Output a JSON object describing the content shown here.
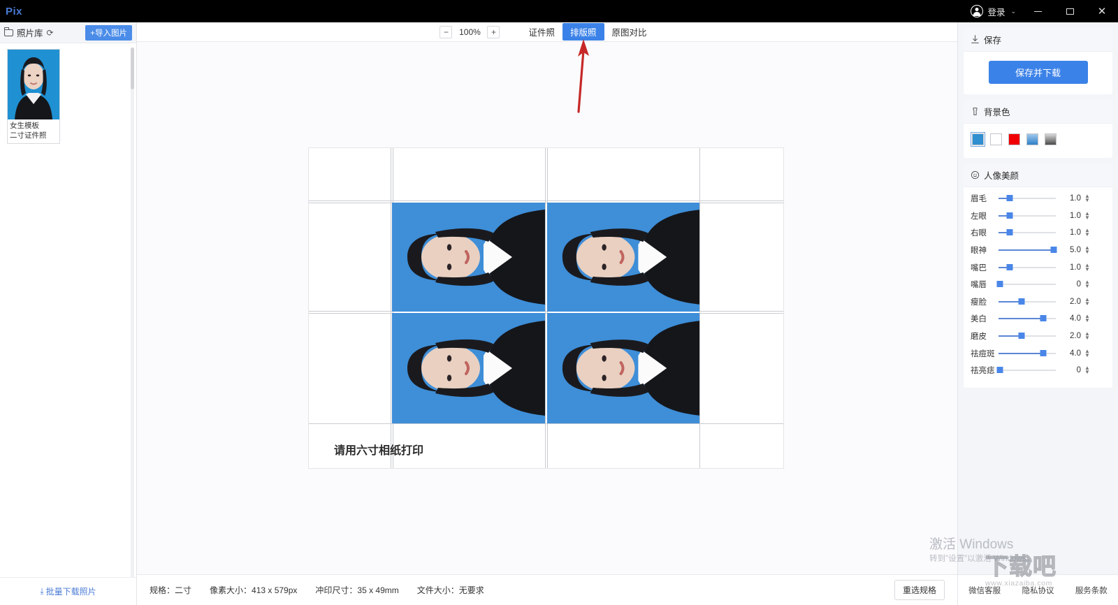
{
  "titlebar": {
    "brand": "Pix",
    "login_label": "登录",
    "chevron": "⌄",
    "minimize": "minimize",
    "maximize": "maximize",
    "close": "✕"
  },
  "sidebar": {
    "library_title": "照片库",
    "refresh_icon": "⟳",
    "import_label": "+导入图片",
    "photos": [
      {
        "name": "女生模板",
        "spec": "二寸证件照"
      }
    ],
    "batch_download": "批量下载照片",
    "batch_download_icon": "⤓"
  },
  "toolbar": {
    "zoom_out": "−",
    "zoom_value": "100%",
    "zoom_in": "+",
    "tabs": [
      {
        "label": "证件照",
        "active": false
      },
      {
        "label": "排版照",
        "active": true
      },
      {
        "label": "原图对比",
        "active": false
      }
    ]
  },
  "canvas": {
    "sheet_note": "请用六寸相纸打印",
    "photo_count": 4,
    "background_color": "#3e8ed8",
    "annotation": {
      "type": "arrow",
      "color": "#c62828",
      "points_to": "排版照"
    }
  },
  "right_panel": {
    "save": {
      "title": "保存",
      "icon": "download-icon",
      "button_label": "保存并下载"
    },
    "background": {
      "title": "背景色",
      "icon": "palette-icon",
      "swatches": [
        {
          "name": "blue",
          "color": "#2f8fd0",
          "selected": true
        },
        {
          "name": "white",
          "color": "#ffffff",
          "selected": false
        },
        {
          "name": "red",
          "color": "#f00000",
          "selected": false
        },
        {
          "name": "blue-gradient",
          "color": "#5fa8e0",
          "selected": false
        },
        {
          "name": "gray-gradient",
          "color": "#808080",
          "selected": false
        }
      ]
    },
    "beauty": {
      "title": "人像美颜",
      "icon": "smiley-icon",
      "sliders": [
        {
          "label": "眉毛",
          "value": "1.0",
          "pct": 20
        },
        {
          "label": "左眼",
          "value": "1.0",
          "pct": 20
        },
        {
          "label": "右眼",
          "value": "1.0",
          "pct": 20
        },
        {
          "label": "眼神",
          "value": "5.0",
          "pct": 96
        },
        {
          "label": "嘴巴",
          "value": "1.0",
          "pct": 20
        },
        {
          "label": "嘴唇",
          "value": "0",
          "pct": 2
        },
        {
          "label": "瘦脸",
          "value": "2.0",
          "pct": 40
        },
        {
          "label": "美白",
          "value": "4.0",
          "pct": 78
        },
        {
          "label": "磨皮",
          "value": "2.0",
          "pct": 40
        },
        {
          "label": "祛痘斑",
          "value": "4.0",
          "pct": 78
        },
        {
          "label": "祛亮痣",
          "value": "0",
          "pct": 2
        }
      ]
    }
  },
  "statusbar": {
    "items": [
      "规格：二寸",
      "像素大小：413 x 579px",
      "冲印尺寸：35 x 49mm",
      "文件大小：无要求"
    ],
    "respec_label": "重选规格",
    "links": [
      "微信客服",
      "隐私协议",
      "服务条款"
    ]
  },
  "watermarks": {
    "windows_line1": "激活 Windows",
    "windows_line2": "转到\"设置\"以激活 Windows。",
    "site_big": "下载吧",
    "site_small": "www.xiazaiba.com"
  }
}
